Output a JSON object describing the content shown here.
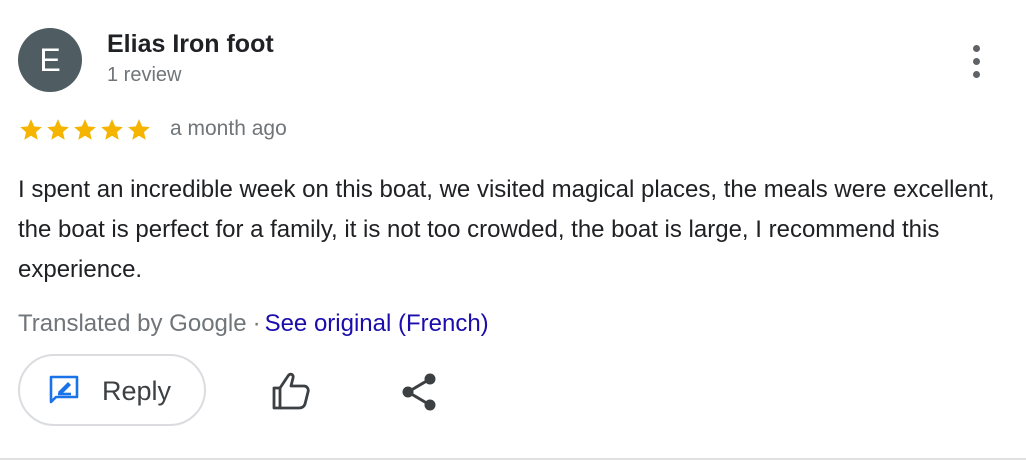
{
  "reviewer": {
    "avatar_letter": "E",
    "name": "Elias Iron foot",
    "review_count": "1 review"
  },
  "rating": {
    "stars": 5,
    "max_stars": 5,
    "star_color": "#f4b400"
  },
  "date": "a month ago",
  "review_text": "I spent an incredible week on this boat, we visited magical places, the meals were excellent, the boat is perfect for a family, it is not too crowded, the boat is large, I recommend this experience.",
  "translation": {
    "translated_by": "Translated by Google",
    "separator": "·",
    "see_original": "See original (French)"
  },
  "actions": {
    "reply_label": "Reply",
    "reply_icon": "reply-edit-icon",
    "like_icon": "thumbs-up-icon",
    "share_icon": "share-icon",
    "more_icon": "more-vertical-icon"
  },
  "colors": {
    "avatar_bg": "#4f5d63",
    "link": "#1a0dab",
    "accent_blue": "#1a73e8"
  }
}
